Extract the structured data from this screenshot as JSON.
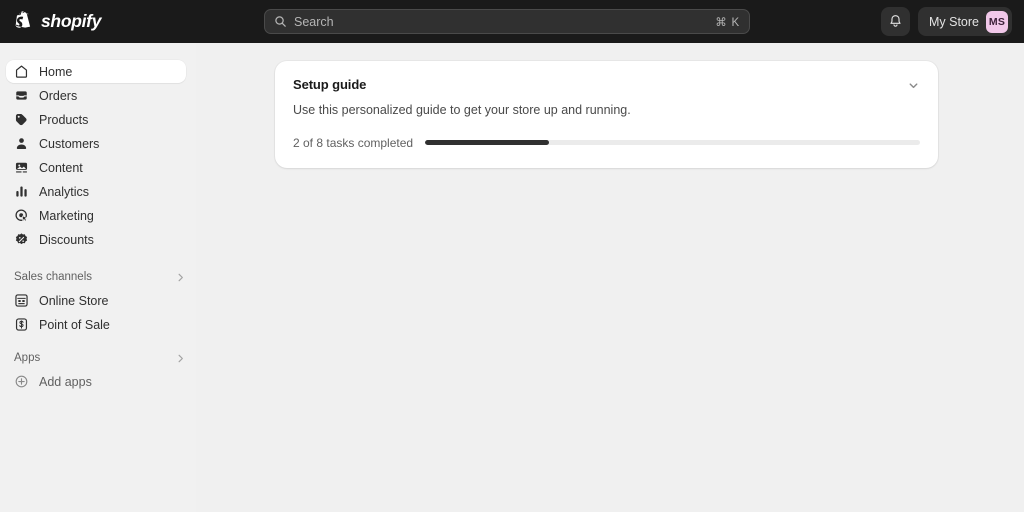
{
  "topbar": {
    "brand_name": "shopify",
    "brand_icon": "shopify-bag-icon",
    "search": {
      "icon": "search-icon",
      "placeholder": "Search",
      "shortcut": "⌘ K"
    },
    "notifications_icon": "bell-icon",
    "store_name": "My Store",
    "avatar_initials": "MS",
    "avatar_color": "#f1c8e9",
    "background_color": "#1a1a1a"
  },
  "sidebar": {
    "background_color": "#f1f1f1",
    "items": [
      {
        "label": "Home",
        "icon": "home-icon",
        "active": true
      },
      {
        "label": "Orders",
        "icon": "orders-inbox-icon",
        "active": false
      },
      {
        "label": "Products",
        "icon": "products-tag-icon",
        "active": false
      },
      {
        "label": "Customers",
        "icon": "customers-person-icon",
        "active": false
      },
      {
        "label": "Content",
        "icon": "content-media-icon",
        "active": false
      },
      {
        "label": "Analytics",
        "icon": "analytics-bars-icon",
        "active": false
      },
      {
        "label": "Marketing",
        "icon": "marketing-target-icon",
        "active": false
      },
      {
        "label": "Discounts",
        "icon": "discounts-percent-icon",
        "active": false
      }
    ],
    "sales_channels": {
      "title": "Sales channels",
      "chevron_icon": "chevron-right-icon",
      "items": [
        {
          "label": "Online Store",
          "icon": "online-store-icon"
        },
        {
          "label": "Point of Sale",
          "icon": "point-of-sale-icon"
        }
      ]
    },
    "apps": {
      "title": "Apps",
      "chevron_icon": "chevron-right-icon",
      "items": [
        {
          "label": "Add apps",
          "icon": "plus-circle-icon"
        }
      ]
    }
  },
  "main": {
    "setup_guide": {
      "title": "Setup guide",
      "description": "Use this personalized guide to get your store up and running.",
      "collapse_icon": "chevron-down-icon",
      "progress_label": "2 of 8 tasks completed",
      "tasks_completed": 2,
      "tasks_total": 8,
      "progress_percent": 25,
      "fill_color": "#303030",
      "track_color": "#ebebeb"
    }
  }
}
